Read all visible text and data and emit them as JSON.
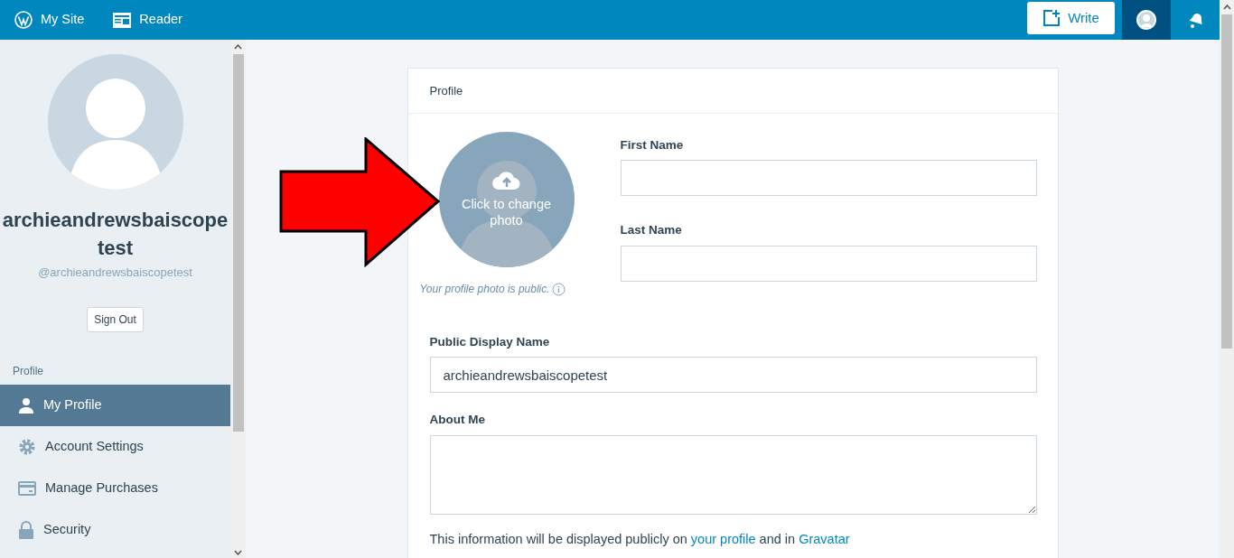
{
  "topbar": {
    "items": [
      {
        "label": "My Site"
      },
      {
        "label": "Reader"
      }
    ],
    "write_button": "Write"
  },
  "sidebar": {
    "display_name": "archieandrewsbaiscopetest",
    "username": "@archieandrewsbaiscopetest",
    "sign_out": "Sign Out",
    "section": "Profile",
    "items": [
      {
        "label": "My Profile",
        "selected": true
      },
      {
        "label": "Account Settings",
        "selected": false
      },
      {
        "label": "Manage Purchases",
        "selected": false
      },
      {
        "label": "Security",
        "selected": false
      }
    ]
  },
  "profile_card": {
    "title": "Profile",
    "photo_hint": "Click to change photo",
    "photo_note": "Your profile photo is public.",
    "fields": [
      {
        "kind": "input",
        "label": "First Name"
      },
      {
        "kind": "input",
        "label": "Last Name"
      },
      {
        "kind": "input",
        "label": "Public Display Name",
        "value": "archieandrewsbaiscopetest"
      },
      {
        "kind": "textarea",
        "label": "About Me"
      }
    ],
    "info_text": [
      {
        "kind": "text",
        "text": "This information will be displayed publicly on"
      },
      {
        "kind": "link",
        "text": "your profile"
      },
      {
        "kind": "text",
        "text": "and in"
      },
      {
        "kind": "link",
        "text": "Gravatar"
      }
    ]
  }
}
